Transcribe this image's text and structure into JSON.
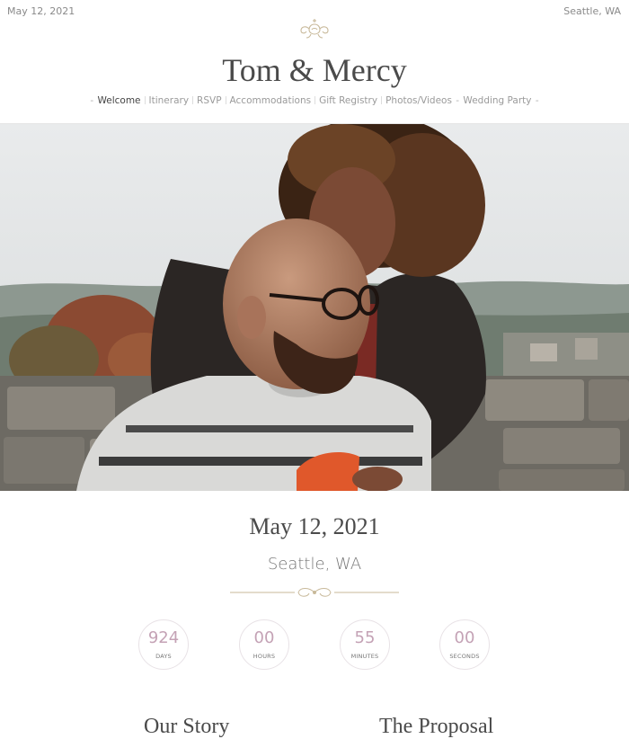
{
  "topbar": {
    "date": "May 12, 2021",
    "location": "Seattle, WA"
  },
  "site": {
    "title": "Tom & Mercy"
  },
  "nav": {
    "items": [
      {
        "label": "Welcome"
      },
      {
        "label": "Itinerary"
      },
      {
        "label": "RSVP"
      },
      {
        "label": "Accommodations"
      },
      {
        "label": "Gift Registry"
      },
      {
        "label": "Photos/Videos"
      },
      {
        "label": "Wedding Party"
      }
    ]
  },
  "event": {
    "date": "May 12, 2021",
    "location": "Seattle, WA"
  },
  "countdown": {
    "days": {
      "value": "924",
      "label": "DAYS"
    },
    "hours": {
      "value": "00",
      "label": "HOURS"
    },
    "minutes": {
      "value": "55",
      "label": "MINUTES"
    },
    "seconds": {
      "value": "00",
      "label": "SECONDS"
    }
  },
  "sections": {
    "story": "Our Story",
    "proposal": "The Proposal"
  },
  "colors": {
    "accent": "#c4a2b5",
    "ornament": "#c8b99a",
    "text": "#4a4a4a"
  }
}
